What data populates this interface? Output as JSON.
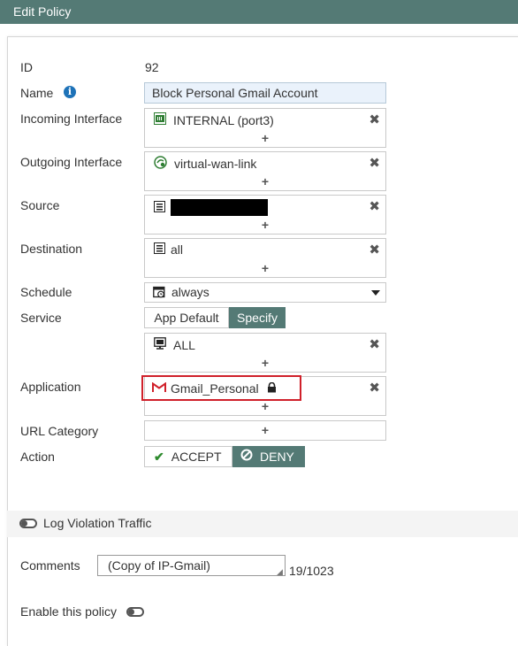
{
  "window": {
    "title": "Edit Policy"
  },
  "fields": {
    "id": {
      "label": "ID",
      "value": "92"
    },
    "name": {
      "label": "Name",
      "value": "Block Personal Gmail Account"
    },
    "incoming": {
      "label": "Incoming Interface",
      "entry": "INTERNAL (port3)"
    },
    "outgoing": {
      "label": "Outgoing Interface",
      "entry": "virtual-wan-link"
    },
    "source": {
      "label": "Source",
      "entry": ""
    },
    "destination": {
      "label": "Destination",
      "entry": "all"
    },
    "schedule": {
      "label": "Schedule",
      "value": "always"
    },
    "service": {
      "label": "Service",
      "option_app_default": "App Default",
      "option_specify": "Specify",
      "entry": "ALL"
    },
    "application": {
      "label": "Application",
      "entry": "Gmail_Personal"
    },
    "url_category": {
      "label": "URL Category"
    },
    "action": {
      "label": "Action",
      "accept": "ACCEPT",
      "deny": "DENY"
    }
  },
  "add_symbol": "+",
  "remove_symbol": "✖",
  "log_violation": {
    "label": "Log Violation Traffic"
  },
  "comments": {
    "label": "Comments",
    "value": "(Copy of IP-Gmail)",
    "counter": "19/1023"
  },
  "enable_policy": {
    "label": "Enable this policy"
  },
  "colors": {
    "header": "#547a75",
    "accent_blue": "#1d72b8",
    "highlight": "#d0202a",
    "accept_green": "#2e8b2e"
  }
}
